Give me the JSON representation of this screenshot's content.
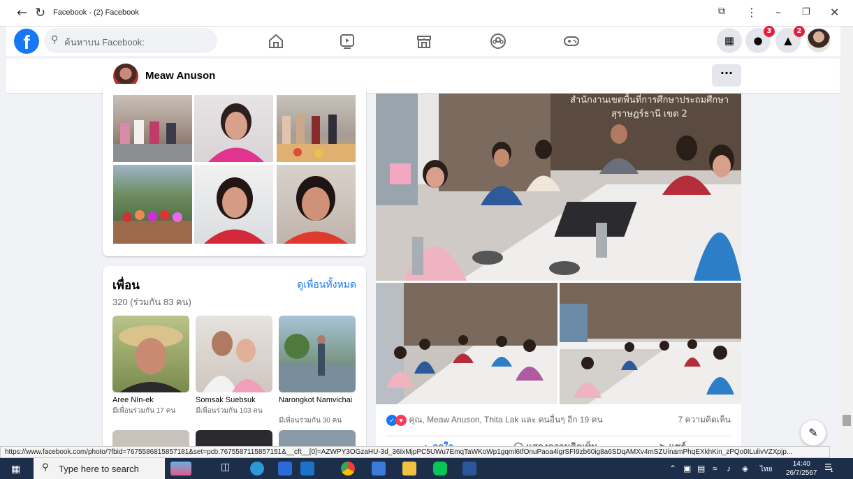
{
  "window": {
    "title": "Facebook - (2) Facebook"
  },
  "header": {
    "search_placeholder": "ค้นหาบน Facebook:",
    "messenger_badge": "3",
    "notifications_badge": "2"
  },
  "profile": {
    "name": "Meaw Anuson",
    "more_label": "···"
  },
  "friends": {
    "title": "เพื่อน",
    "see_all": "ดูเพื่อนทั้งหมด",
    "count": "320 (ร่วมกัน 83 คน)",
    "items": [
      {
        "name": "Aree NIn-ek",
        "mutual": "มีเพื่อนร่วมกัน 17 คน"
      },
      {
        "name": "Somsak Suebsuk",
        "mutual": "มีเพื่อนร่วมกัน 103 คน"
      },
      {
        "name": "Narongkot Namvichai",
        "mutual": "มีเพื่อนร่วมกัน 30 คน"
      }
    ]
  },
  "post": {
    "banner_text_1": "สำนักงานเขตพื้นที่การศึกษาประถมศึกษา",
    "banner_text_2": "สุราษฎร์ธานี เขต 2",
    "reactions_text": "คุณ, Meaw Anuson, Thita Lak และ คนอื่นๆ อีก 19 คน",
    "comments_text": "7 ความคิดเห็น",
    "like_label": "ถูกใจ",
    "comment_label": "แสดงความคิดเห็น",
    "share_label": "แชร์"
  },
  "status_url": "https://www.facebook.com/photo/?fbid=7675586815857181&set=pcb.7675587115857151&__cft__[0]=AZWPY3OGzaHU-3d_36IxMjpPC5UWu7EmqTaWKoWp1gqml6tfOnuPaoa4igrSFI9zb60ig8a6SDqAMXv4mSZUinamPhqEXkhKin_zPQo0ILulivVZXpjp...",
  "taskbar": {
    "search_placeholder": "Type here to search",
    "language": "ไทย",
    "time": "14:40",
    "date": "26/7/2567",
    "notif_count": "1"
  },
  "colors": {
    "facebook_blue": "#1877f2",
    "badge_red": "#e41e3f",
    "taskbar": "#1c2e4a"
  }
}
